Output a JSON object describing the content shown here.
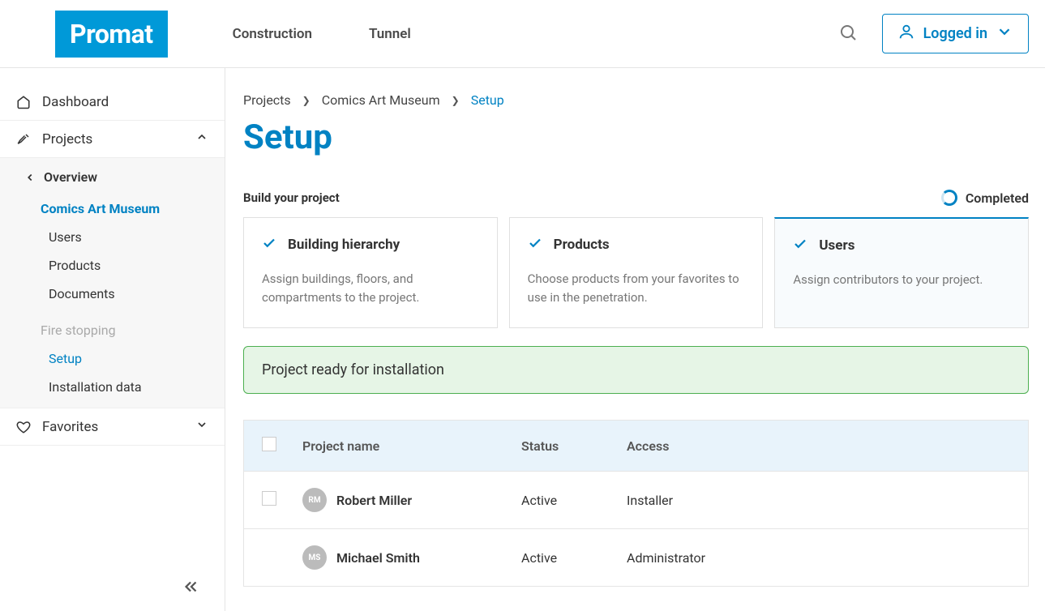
{
  "header": {
    "logo": "Promat",
    "nav": [
      "Construction",
      "Tunnel"
    ],
    "login_label": "Logged in"
  },
  "sidebar": {
    "dashboard": "Dashboard",
    "projects": "Projects",
    "overview": "Overview",
    "project_name": "Comics Art Museum",
    "users": "Users",
    "products": "Products",
    "documents": "Documents",
    "fire_stopping": "Fire stopping",
    "setup": "Setup",
    "installation_data": "Installation data",
    "favorites": "Favorites"
  },
  "breadcrumb": {
    "p0": "Projects",
    "p1": "Comics Art Museum",
    "p2": "Setup"
  },
  "page_title": "Setup",
  "section": {
    "label": "Build your project",
    "completed": "Completed"
  },
  "cards": [
    {
      "title": "Building hierarchy",
      "desc": "Assign buildings, floors, and compartments to the project."
    },
    {
      "title": "Products",
      "desc": "Choose products from your favorites to use in the penetration."
    },
    {
      "title": "Users",
      "desc": "Assign contributors to your project."
    }
  ],
  "banner": "Project ready for installation",
  "table": {
    "columns": {
      "name": "Project name",
      "status": "Status",
      "access": "Access"
    },
    "rows": [
      {
        "initials": "RM",
        "name": "Robert Miller",
        "status": "Active",
        "access": "Installer",
        "checkable": true
      },
      {
        "initials": "MS",
        "name": "Michael Smith",
        "status": "Active",
        "access": "Administrator",
        "checkable": false
      }
    ]
  }
}
